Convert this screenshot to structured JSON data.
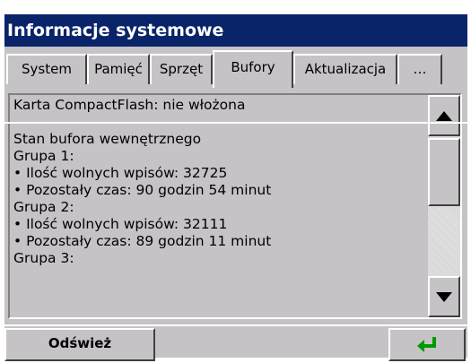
{
  "window": {
    "title": "Informacje systemowe"
  },
  "tabs": [
    {
      "label": "System",
      "active": false
    },
    {
      "label": "Pamięć",
      "active": false
    },
    {
      "label": "Sprzęt",
      "active": false
    },
    {
      "label": "Bufory",
      "active": true
    },
    {
      "label": "Aktualizacja",
      "active": false
    },
    {
      "label": "…",
      "active": false
    }
  ],
  "content": {
    "lines": [
      "Karta CompactFlash: nie włożona",
      "--",
      "Stan bufora wewnętrznego",
      "Grupa 1:",
      " • Ilość wolnych wpisów: 32725",
      " • Pozostały czas: 90 godzin 54 minut",
      "Grupa 2:",
      " • Ilość wolnych wpisów: 32111",
      " • Pozostały czas: 89 godzin 11 minut",
      "Grupa 3:"
    ]
  },
  "scrollbar": {
    "up_icon": "triangle-up",
    "down_icon": "triangle-down"
  },
  "bottombar": {
    "refresh_label": "Odśwież",
    "enter_icon": "enter-arrow",
    "enter_color": "#009a00"
  }
}
